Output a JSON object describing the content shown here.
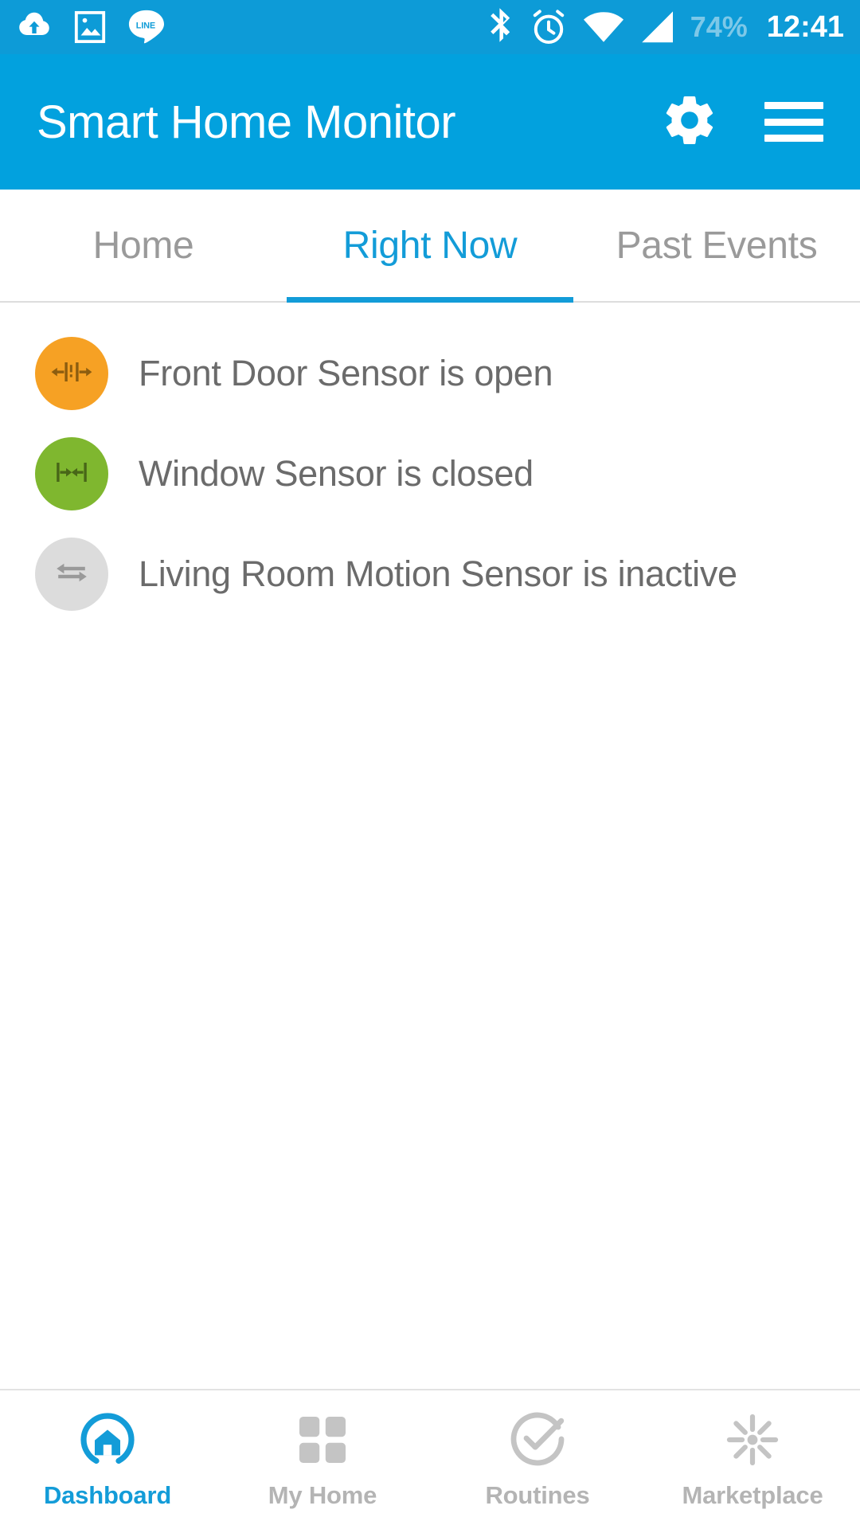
{
  "statusbar": {
    "left_icons": [
      "cloud-upload-icon",
      "photo-icon",
      "line-app-icon"
    ],
    "right_icons": [
      "bluetooth-icon",
      "alarm-clock-icon",
      "wifi-icon",
      "cellular-signal-icon"
    ],
    "battery": "74%",
    "time": "12:41",
    "background_color": "#0D9BD7",
    "battery_color": "#7DC8E8",
    "time_color": "#FFFFFF"
  },
  "appbar": {
    "title": "Smart Home Monitor",
    "background_color": "#02A1DE",
    "settings_icon": "gear-icon",
    "menu_icon": "hamburger-menu-icon"
  },
  "tabs": {
    "active_color": "#139CD8",
    "inactive_color": "#9A9A9A",
    "items": [
      {
        "label": "Home",
        "active": false
      },
      {
        "label": "Right Now",
        "active": true
      },
      {
        "label": "Past Events",
        "active": false
      }
    ]
  },
  "sensors": [
    {
      "label": "Front Door Sensor is open",
      "status": "open",
      "badge_color": "#F6A124",
      "icon": "door-open-arrows-icon",
      "icon_color": "#8C5D10"
    },
    {
      "label": "Window Sensor is closed",
      "status": "closed",
      "badge_color": "#7FB72F",
      "icon": "door-closed-arrows-icon",
      "icon_color": "#486618"
    },
    {
      "label": "Living Room Motion Sensor is inactive",
      "status": "inactive",
      "badge_color": "#DCDCDC",
      "icon": "motion-arrows-icon",
      "icon_color": "#9A9A9A"
    }
  ],
  "bottomnav": {
    "active_color": "#139CD8",
    "inactive_color": "#B4B4B4",
    "items": [
      {
        "label": "Dashboard",
        "icon": "home-dashboard-icon",
        "active": true
      },
      {
        "label": "My Home",
        "icon": "grid-squares-icon",
        "active": false
      },
      {
        "label": "Routines",
        "icon": "check-circle-icon",
        "active": false
      },
      {
        "label": "Marketplace",
        "icon": "starburst-icon",
        "active": false
      }
    ]
  }
}
